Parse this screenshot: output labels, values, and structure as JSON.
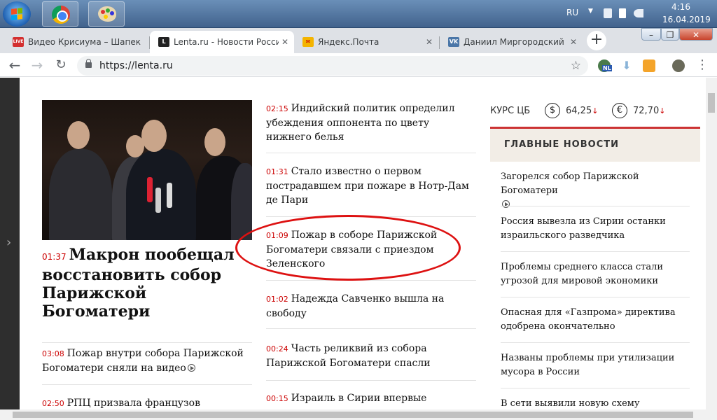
{
  "taskbar": {
    "lang": "RU",
    "time": "4:16",
    "date": "16.04.2019"
  },
  "tabs": [
    {
      "fav_text": "LIVE",
      "fav_color": "#d32f2f",
      "label": "Видео Крисиума – Шапек"
    },
    {
      "fav_text": "L",
      "fav_color": "#222222",
      "label": "Lenta.ru - Новости России"
    },
    {
      "fav_text": "✉",
      "fav_color": "#f4b400",
      "label": "Яндекс.Почта"
    },
    {
      "fav_text": "VK",
      "fav_color": "#4a76a8",
      "label": "Даниил Миргородский"
    }
  ],
  "toolbar": {
    "url": "https://lenta.ru",
    "ext_nl": "NL"
  },
  "feature": {
    "time": "01:37",
    "title": "Макрон пообещал восстановить собор Парижской Богоматери"
  },
  "left_news": [
    {
      "time": "03:08",
      "title": "Пожар внутри собора Парижской Богоматери сняли на видео",
      "video": true
    },
    {
      "time": "02:50",
      "title": "РПЦ призвала французов",
      "video": false
    }
  ],
  "middle_news": [
    {
      "time": "02:15",
      "title": "Индийский политик определил убеждения оппонента по цвету нижнего белья"
    },
    {
      "time": "01:31",
      "title": "Стало известно о первом пострадавшем при пожаре в Нотр-Дам де Пари"
    },
    {
      "time": "01:09",
      "title": "Пожар в соборе Парижской Богоматери связали с приездом Зеленского"
    },
    {
      "time": "01:02",
      "title": "Надежда Савченко вышла на свободу"
    },
    {
      "time": "00:24",
      "title": "Часть реликвий из собора Парижской Богоматери спасли"
    },
    {
      "time": "00:15",
      "title": "Израиль в Сирии впервые"
    }
  ],
  "rates": {
    "label": "КУРС ЦБ",
    "usd_symbol": "$",
    "usd": "64,25",
    "eur_symbol": "€",
    "eur": "72,70",
    "arrow": "↓"
  },
  "main_news": {
    "header": "ГЛАВНЫЕ НОВОСТИ",
    "items": [
      {
        "title": "Загорелся собор Парижской Богоматери",
        "video": true
      },
      {
        "title": "Россия вывезла из Сирии останки израильского разведчика",
        "video": false
      },
      {
        "title": "Проблемы среднего класса стали угрозой для мировой экономики",
        "video": false
      },
      {
        "title": "Опасная для «Газпрома» директива одобрена окончательно",
        "video": false
      },
      {
        "title": "Названы проблемы при утилизации мусора в России",
        "video": false
      },
      {
        "title": "В сети выявили новую схему",
        "video": false
      }
    ]
  },
  "colors": {
    "accent_red": "#cc0000",
    "annotation_red": "#dd1111"
  }
}
